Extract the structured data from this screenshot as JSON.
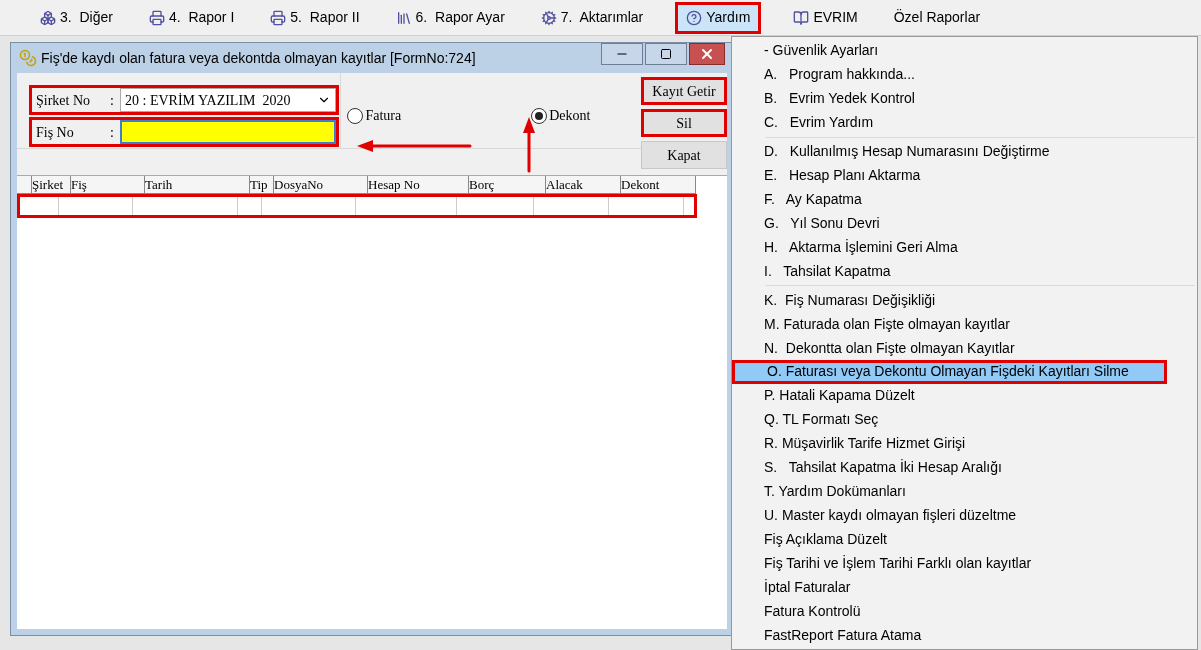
{
  "menubar": [
    {
      "label": "3.  Diğer",
      "selected": false,
      "annotated": false
    },
    {
      "label": "4.  Rapor I",
      "selected": false,
      "annotated": false
    },
    {
      "label": "5.  Rapor II",
      "selected": false,
      "annotated": false
    },
    {
      "label": "6.  Rapor Ayar",
      "selected": false,
      "annotated": false
    },
    {
      "label": "7.  Aktarımlar",
      "selected": false,
      "annotated": false
    },
    {
      "label": "Yardım",
      "selected": true,
      "annotated": true
    },
    {
      "label": "EVRIM",
      "selected": false,
      "annotated": false
    },
    {
      "label": "Özel Raporlar",
      "selected": false,
      "annotated": false
    }
  ],
  "window": {
    "title": "Fiş'de kaydı olan fatura veya dekontda olmayan kayıtlar [FormNo:724]",
    "company": {
      "label": "Şirket No",
      "colon": ":",
      "value": "20 : EVRİM YAZILIM  2020",
      "annotated": true
    },
    "voucher": {
      "label": "Fiş No",
      "colon": ":",
      "annotated": true
    },
    "radios": [
      {
        "label": "Fatura",
        "selected": false
      },
      {
        "label": "Dekont",
        "selected": true
      }
    ],
    "buttons": [
      {
        "label": "Kayıt Getir",
        "annotated": true
      },
      {
        "label": "Sil",
        "annotated": true
      },
      {
        "label": "Kapat",
        "annotated": false
      }
    ],
    "table": {
      "columns": [
        "Şirket",
        "Fiş",
        "Tarih",
        "Tip",
        "DosyaNo",
        "Hesap No",
        "Borç",
        "Alacak",
        "Dekont"
      ],
      "row_annotated": true
    }
  },
  "menu": {
    "groups": [
      [
        {
          "label": "- Güvenlik Ayarları",
          "selected": false
        },
        {
          "label": "A.   Program hakkında...",
          "selected": false
        },
        {
          "label": "B.   Evrim Yedek Kontrol",
          "selected": false
        },
        {
          "label": "C.   Evrim Yardım",
          "selected": false
        }
      ],
      [
        {
          "label": "D.   Kullanılmış Hesap Numarasını Değiştirme",
          "selected": false
        },
        {
          "label": "E.   Hesap Planı Aktarma",
          "selected": false
        },
        {
          "label": "F.   Ay Kapatma",
          "selected": false
        },
        {
          "label": "G.   Yıl Sonu Devri",
          "selected": false
        },
        {
          "label": "H.   Aktarma İşlemini Geri Alma",
          "selected": false
        },
        {
          "label": "I.   Tahsilat Kapatma",
          "selected": false
        }
      ],
      [
        {
          "label": "K.  Fiş Numarası Değişikliği",
          "selected": false
        },
        {
          "label": "M. Faturada olan Fişte olmayan kayıtlar",
          "selected": false
        },
        {
          "label": "N.  Dekontta olan Fişte olmayan Kayıtlar",
          "selected": false
        },
        {
          "label": "O. Faturası veya Dekontu Olmayan Fişdeki Kayıtları Silme",
          "selected": true
        },
        {
          "label": "P. Hatali Kapama Düzelt",
          "selected": false
        },
        {
          "label": "Q. TL Formatı Seç",
          "selected": false
        },
        {
          "label": "R. Müşavirlik Tarife Hizmet Girişi",
          "selected": false
        },
        {
          "label": "S.   Tahsilat Kapatma İki Hesap Aralığı",
          "selected": false
        },
        {
          "label": "T. Yardım Dokümanları",
          "selected": false
        },
        {
          "label": "U. Master kaydı olmayan fişleri düzeltme",
          "selected": false
        },
        {
          "label": "Fiş Açıklama Düzelt",
          "selected": false
        },
        {
          "label": "Fiş Tarihi ve İşlem Tarihi Farklı olan kayıtlar",
          "selected": false
        },
        {
          "label": "İptal Faturalar",
          "selected": false
        },
        {
          "label": "Fatura Kontrolü",
          "selected": false
        },
        {
          "label": "FastReport Fatura Atama",
          "selected": false
        }
      ]
    ]
  }
}
